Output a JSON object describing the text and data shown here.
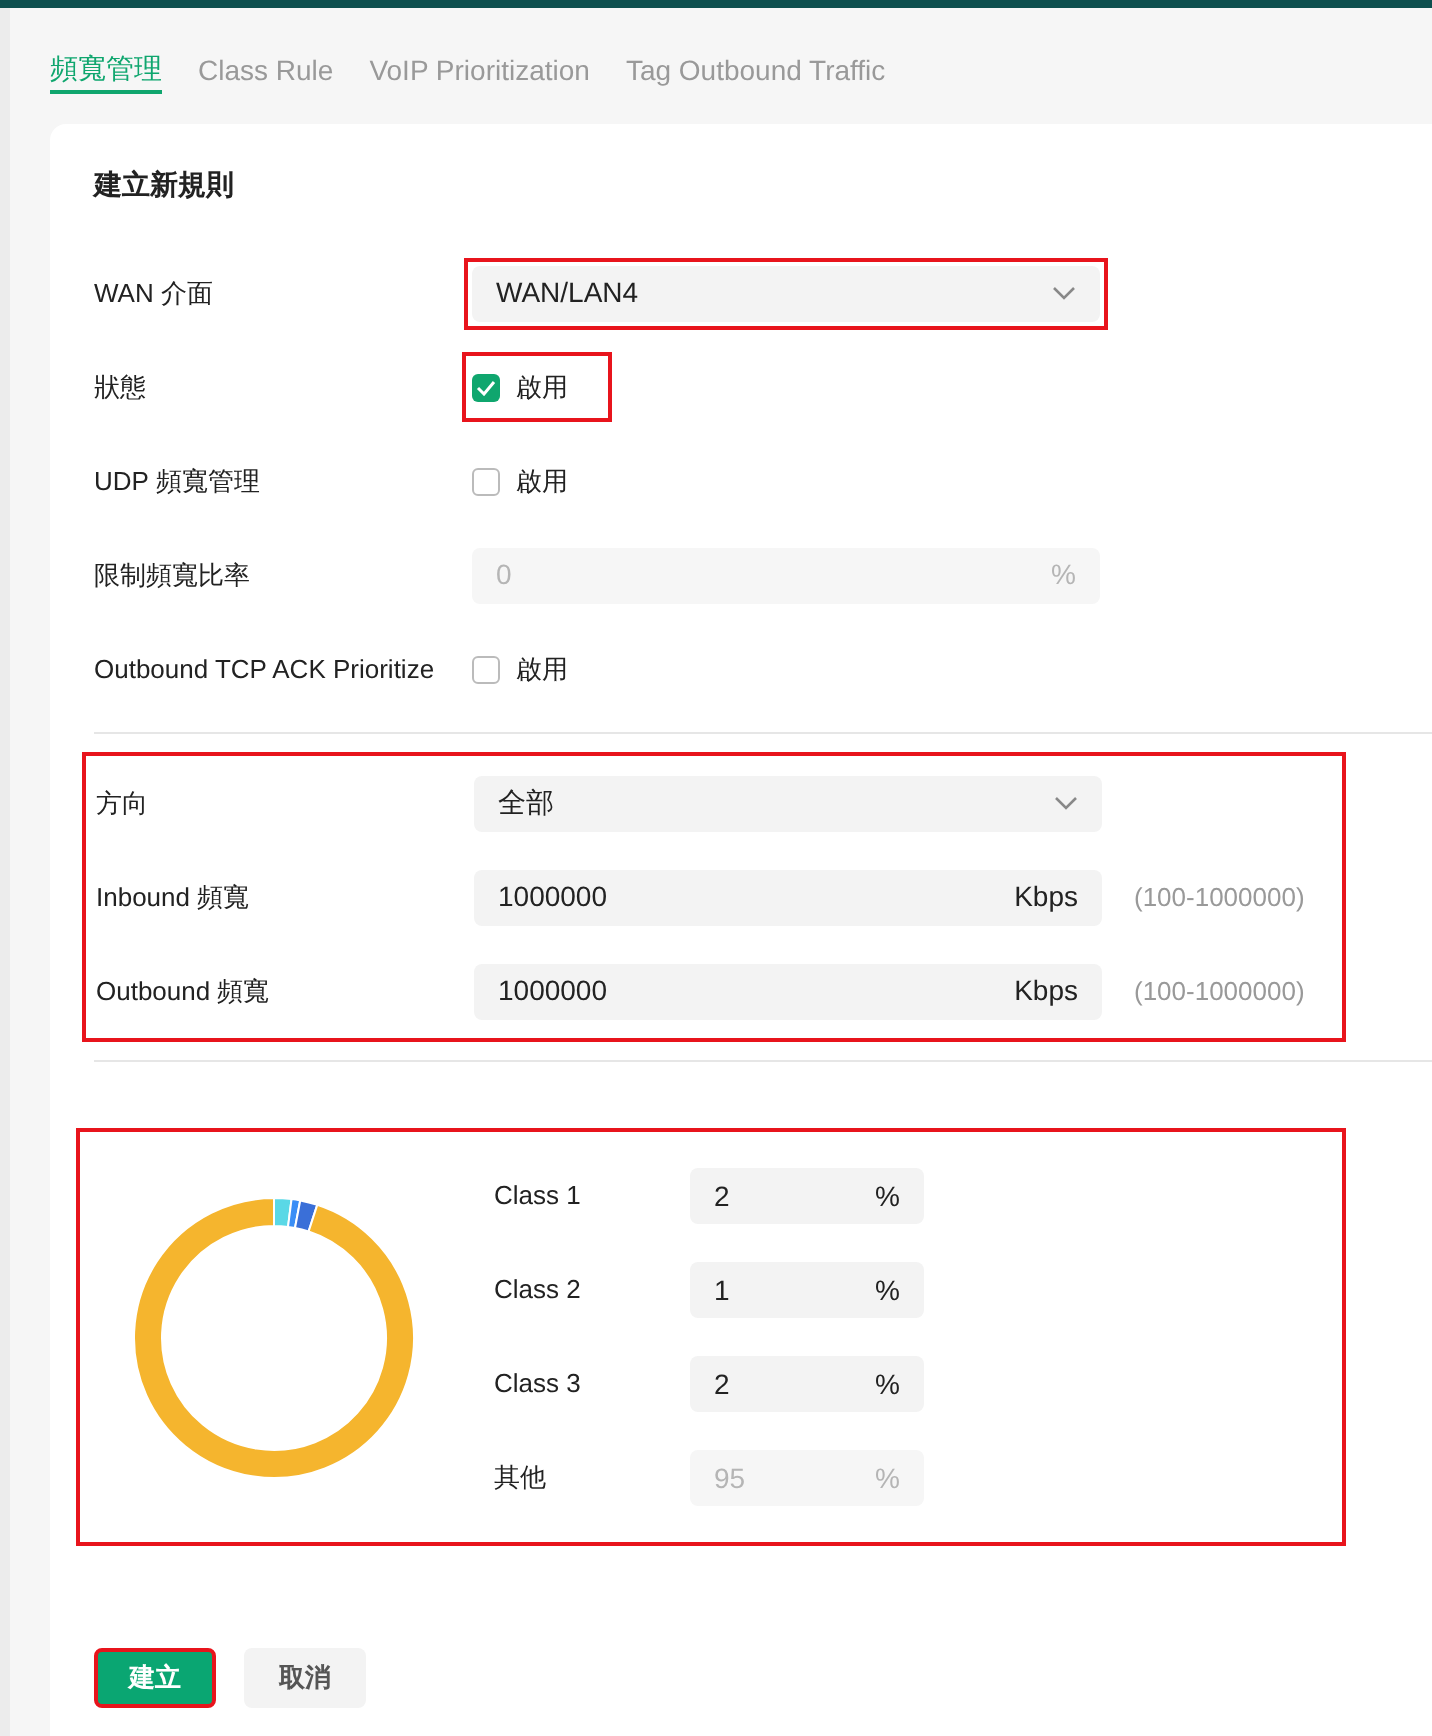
{
  "tabs": [
    {
      "label": "頻寬管理",
      "selected": true
    },
    {
      "label": "Class Rule",
      "selected": false
    },
    {
      "label": "VoIP Prioritization",
      "selected": false
    },
    {
      "label": "Tag Outbound Traffic",
      "selected": false
    }
  ],
  "form": {
    "title": "建立新規則",
    "general": [
      {
        "kind": "select",
        "label": "WAN 介面",
        "value": "WAN/LAN4",
        "highlighted": true
      },
      {
        "kind": "checkbox",
        "label": "狀態",
        "text": "啟用",
        "checked": true,
        "highlighted": true
      },
      {
        "kind": "checkbox",
        "label": "UDP 頻寬管理",
        "text": "啟用",
        "checked": false
      },
      {
        "kind": "input",
        "label": "限制頻寬比率",
        "value": "0",
        "unit": "%",
        "disabled": true
      },
      {
        "kind": "checkbox",
        "label": "Outbound TCP ACK Prioritize",
        "text": "啟用",
        "checked": false
      }
    ],
    "bandwidth": {
      "highlighted": true,
      "rows": [
        {
          "kind": "select",
          "label": "方向",
          "value": "全部"
        },
        {
          "kind": "input",
          "label": "Inbound 頻寬",
          "value": "1000000",
          "unit": "Kbps",
          "disabled": false,
          "range": "(100-1000000)"
        },
        {
          "kind": "input",
          "label": "Outbound 頻寬",
          "value": "1000000",
          "unit": "Kbps",
          "disabled": false,
          "range": "(100-1000000)"
        }
      ]
    },
    "classes": {
      "highlighted": true,
      "rows": [
        {
          "label": "Class 1",
          "value": "2",
          "unit": "%",
          "disabled": false
        },
        {
          "label": "Class 2",
          "value": "1",
          "unit": "%",
          "disabled": false
        },
        {
          "label": "Class 3",
          "value": "2",
          "unit": "%",
          "disabled": false
        },
        {
          "label": "其他",
          "value": "95",
          "unit": "%",
          "disabled": true
        }
      ]
    },
    "buttons": [
      {
        "kind": "primary",
        "label": "建立",
        "highlighted": true
      },
      {
        "kind": "secondary",
        "label": "取消",
        "highlighted": false
      }
    ]
  }
}
